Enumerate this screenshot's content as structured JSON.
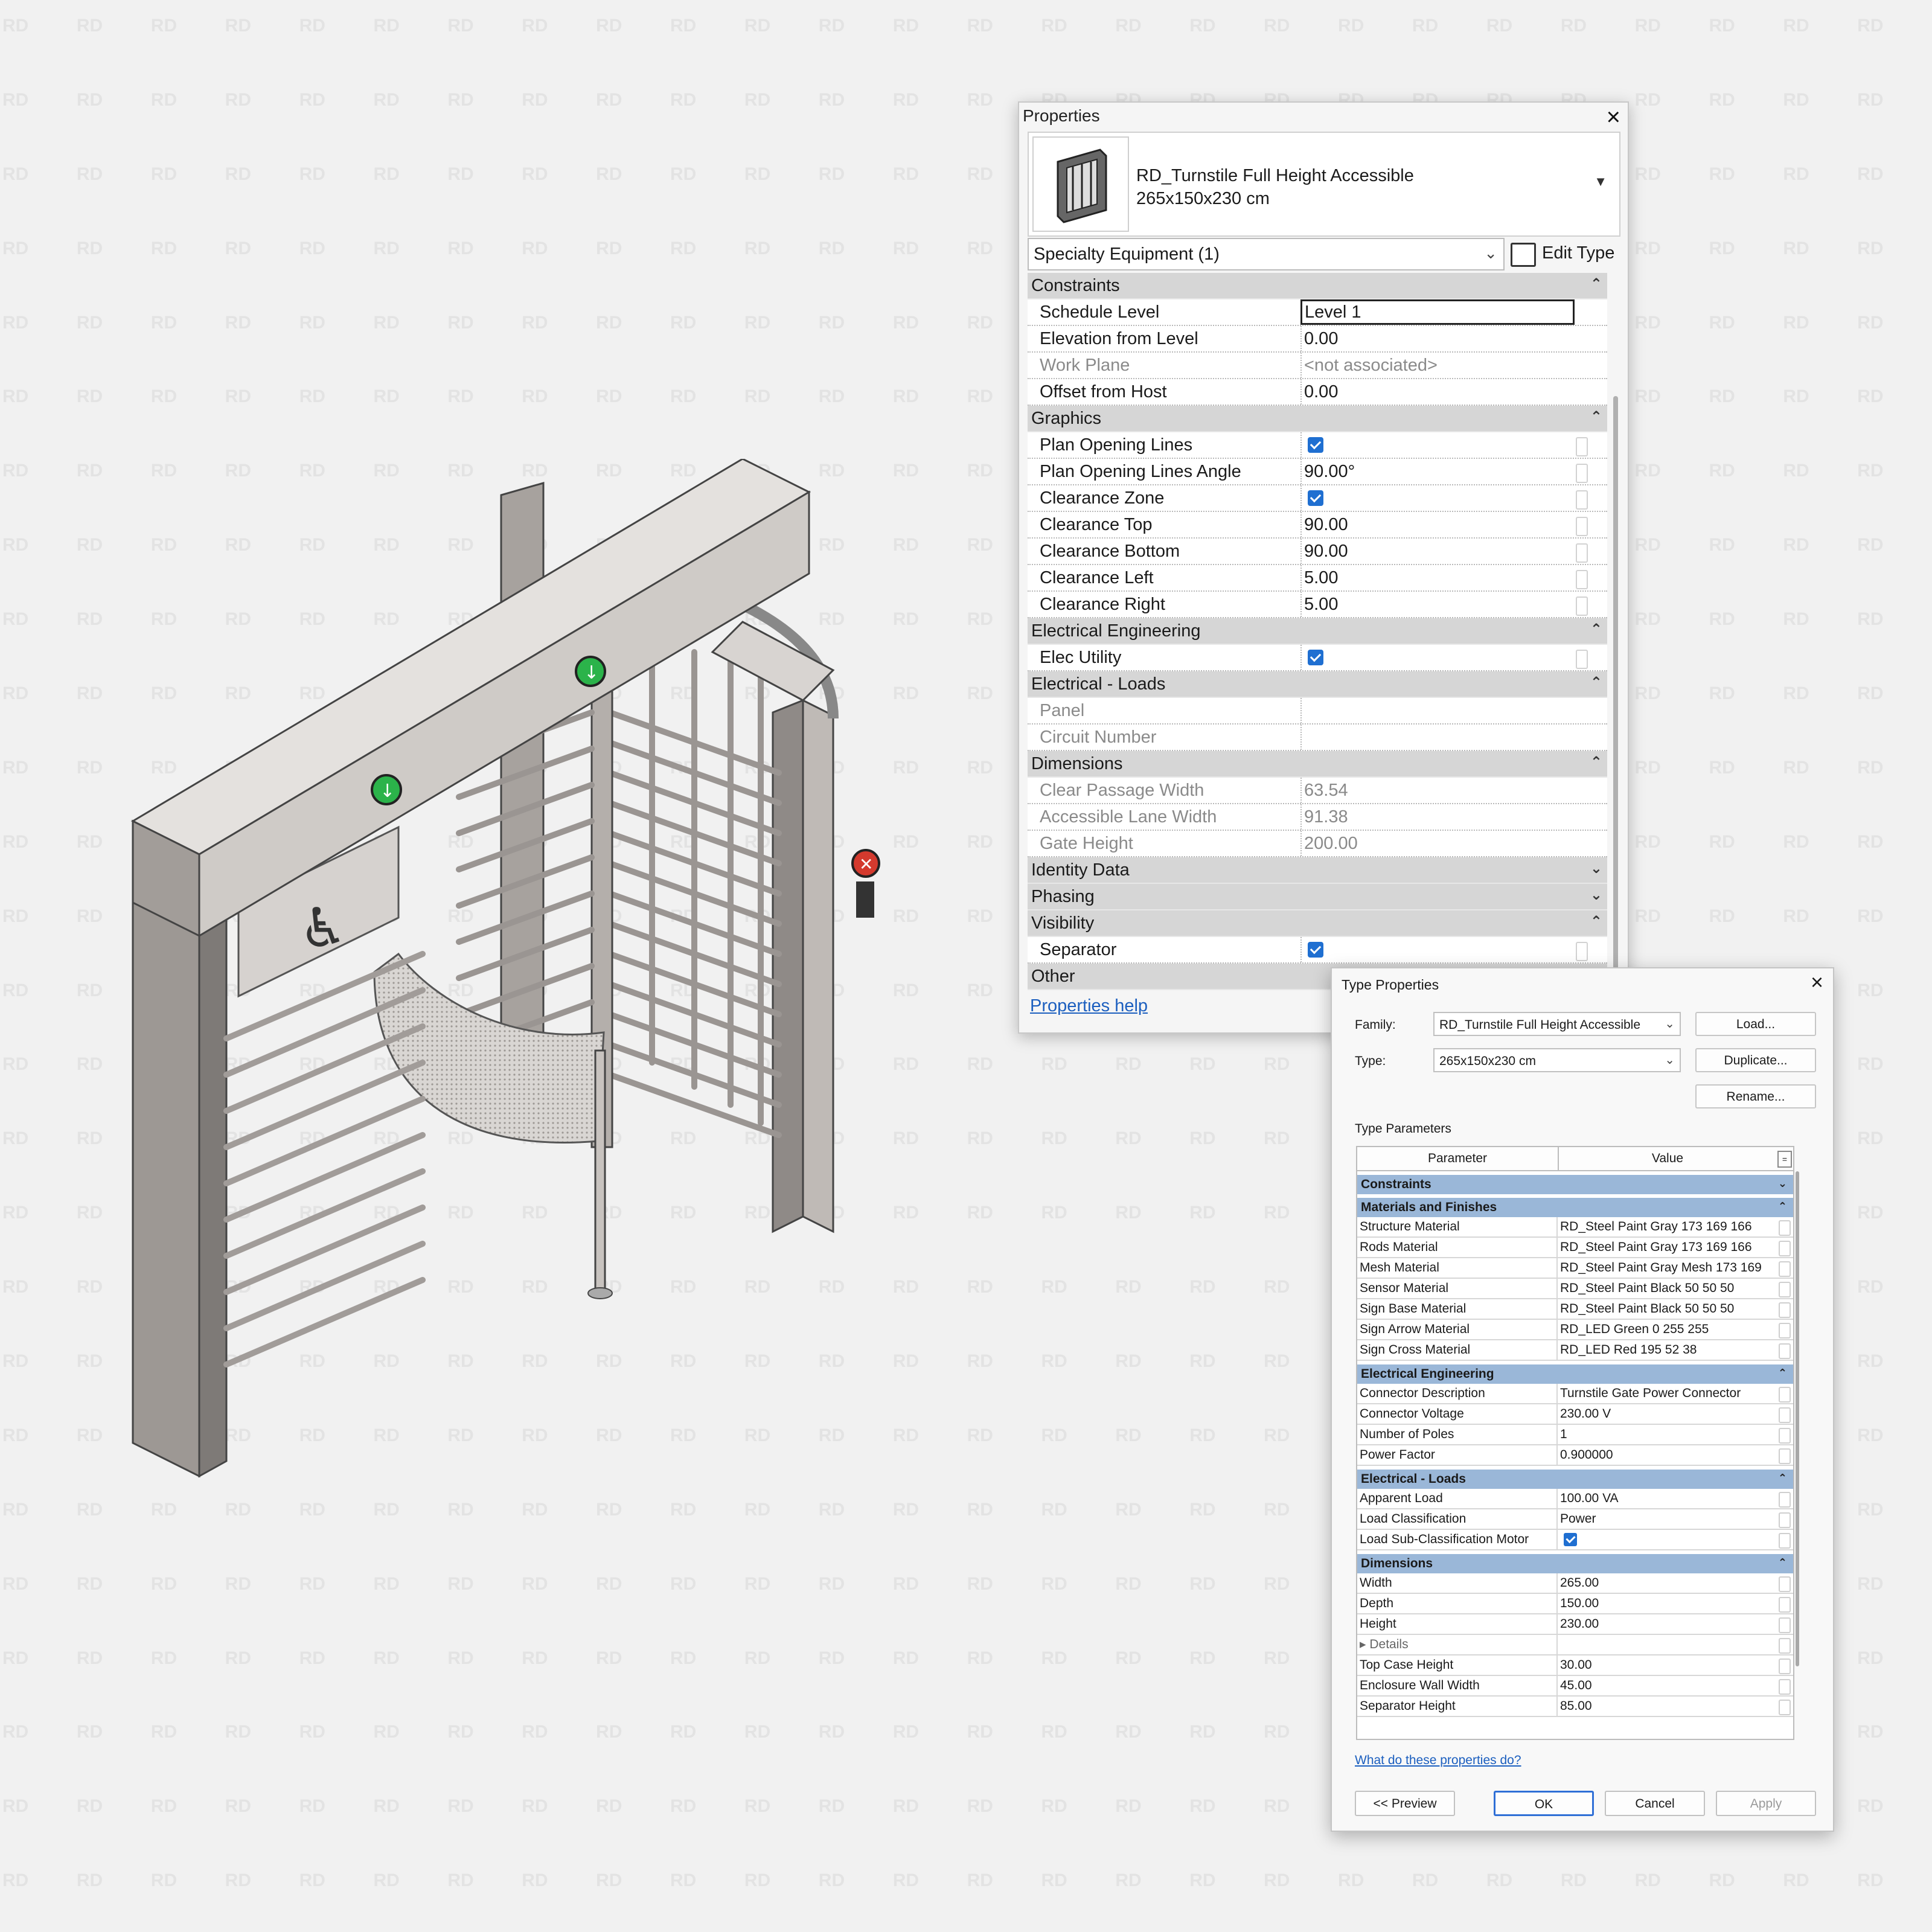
{
  "watermark_text": "RD",
  "properties_palette": {
    "title": "Properties",
    "close_icon": "close-icon",
    "type_name_line1": "RD_Turnstile Full Height Accessible",
    "type_name_line2": "265x150x230 cm",
    "category_selector": "Specialty Equipment (1)",
    "edit_type_label": "Edit Type",
    "groups": [
      {
        "label": "Constraints",
        "state": "expanded",
        "rows": [
          {
            "name": "Schedule Level",
            "value": "Level 1",
            "editing": true
          },
          {
            "name": "Elevation from Level",
            "value": "0.00"
          },
          {
            "name": "Work Plane",
            "value": "<not associated>",
            "readonly": true
          },
          {
            "name": "Offset from Host",
            "value": "0.00"
          }
        ]
      },
      {
        "label": "Graphics",
        "state": "expanded",
        "rows": [
          {
            "name": "Plan Opening Lines",
            "checked": true
          },
          {
            "name": "Plan Opening Lines Angle",
            "value": "90.00°"
          },
          {
            "name": "Clearance Zone",
            "checked": true
          },
          {
            "name": "Clearance Top",
            "value": "90.00"
          },
          {
            "name": "Clearance Bottom",
            "value": "90.00"
          },
          {
            "name": "Clearance Left",
            "value": "5.00"
          },
          {
            "name": "Clearance Right",
            "value": "5.00"
          }
        ]
      },
      {
        "label": "Electrical Engineering",
        "state": "expanded",
        "rows": [
          {
            "name": "Elec Utility",
            "checked": true
          }
        ]
      },
      {
        "label": "Electrical - Loads",
        "state": "expanded",
        "rows": [
          {
            "name": "Panel",
            "value": "",
            "readonly": true
          },
          {
            "name": "Circuit Number",
            "value": "",
            "readonly": true
          }
        ]
      },
      {
        "label": "Dimensions",
        "state": "expanded",
        "rows": [
          {
            "name": "Clear Passage Width",
            "value": "63.54",
            "readonly": true
          },
          {
            "name": "Accessible Lane Width",
            "value": "91.38",
            "readonly": true
          },
          {
            "name": "Gate Height",
            "value": "200.00",
            "readonly": true
          }
        ]
      },
      {
        "label": "Identity Data",
        "state": "collapsed",
        "rows": []
      },
      {
        "label": "Phasing",
        "state": "collapsed",
        "rows": []
      },
      {
        "label": "Visibility",
        "state": "expanded",
        "rows": [
          {
            "name": "Separator",
            "checked": true
          }
        ]
      },
      {
        "label": "Other",
        "state": "none",
        "rows": []
      }
    ],
    "help_link": "Properties help"
  },
  "type_properties": {
    "title": "Type Properties",
    "family_label": "Family:",
    "family_value": "RD_Turnstile Full Height Accessible",
    "type_label": "Type:",
    "type_value": "265x150x230 cm",
    "load_button": "Load...",
    "duplicate_button": "Duplicate...",
    "rename_button": "Rename...",
    "type_parameters_label": "Type Parameters",
    "col_parameter": "Parameter",
    "col_value": "Value",
    "col_extra": "=",
    "groups": [
      {
        "label": "Constraints",
        "state": "collapsed",
        "rows": []
      },
      {
        "label": "Materials and Finishes",
        "state": "expanded",
        "rows": [
          {
            "name": "Structure Material",
            "value": "RD_Steel Paint Gray 173 169 166"
          },
          {
            "name": "Rods Material",
            "value": "RD_Steel Paint Gray 173 169 166"
          },
          {
            "name": "Mesh Material",
            "value": "RD_Steel Paint Gray Mesh 173 169"
          },
          {
            "name": "Sensor Material",
            "value": "RD_Steel Paint Black 50 50 50"
          },
          {
            "name": "Sign Base Material",
            "value": "RD_Steel Paint Black 50 50 50"
          },
          {
            "name": "Sign Arrow Material",
            "value": "RD_LED Green 0 255 255"
          },
          {
            "name": "Sign Cross Material",
            "value": "RD_LED Red 195 52 38"
          }
        ]
      },
      {
        "label": "Electrical Engineering",
        "state": "expanded",
        "rows": [
          {
            "name": "Connector Description",
            "value": "Turnstile Gate Power Connector"
          },
          {
            "name": "Connector Voltage",
            "value": "230.00 V"
          },
          {
            "name": "Number of Poles",
            "value": "1"
          },
          {
            "name": "Power Factor",
            "value": "0.900000"
          }
        ]
      },
      {
        "label": "Electrical - Loads",
        "state": "expanded",
        "rows": [
          {
            "name": "Apparent Load",
            "value": "100.00 VA"
          },
          {
            "name": "Load Classification",
            "value": "Power"
          },
          {
            "name": "Load Sub-Classification Motor",
            "checked": true
          }
        ]
      },
      {
        "label": "Dimensions",
        "state": "expanded",
        "rows": [
          {
            "name": "Width",
            "value": "265.00"
          },
          {
            "name": "Depth",
            "value": "150.00"
          },
          {
            "name": "Height",
            "value": "230.00"
          },
          {
            "name": "▸ Details",
            "value": "",
            "sub": true
          },
          {
            "name": "Top Case Height",
            "value": "30.00"
          },
          {
            "name": "Enclosure Wall Width",
            "value": "45.00"
          },
          {
            "name": "Separator Height",
            "value": "85.00"
          }
        ]
      }
    ],
    "help_link": "What do these properties do?",
    "preview_button": "<< Preview",
    "ok_button": "OK",
    "cancel_button": "Cancel",
    "apply_button": "Apply"
  },
  "colors": {
    "accent_blue": "#1f6fd1",
    "group_header_blue": "#9ab7d8",
    "arrow_sign_green": "#2bb34a",
    "cross_sign_red": "#d43a2e",
    "frame_gray": "#cfcbc7"
  }
}
